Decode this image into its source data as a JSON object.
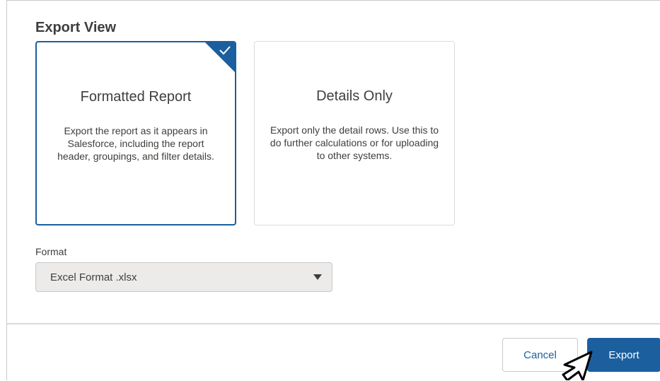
{
  "section": {
    "title": "Export View"
  },
  "cards": [
    {
      "title": "Formatted Report",
      "description": "Export the report as it appears in Salesforce, including the report header, groupings, and filter details.",
      "selected": true
    },
    {
      "title": "Details Only",
      "description": "Export only the detail rows. Use this to do further calculations or for uploading to other systems.",
      "selected": false
    }
  ],
  "format": {
    "label": "Format",
    "selected_value": "Excel Format .xlsx"
  },
  "footer": {
    "cancel_label": "Cancel",
    "export_label": "Export"
  },
  "icons": {
    "selected_check": "check-icon",
    "dropdown": "caret-down-icon",
    "pointer": "mouse-pointer-icon"
  },
  "colors": {
    "brand": "#1b5f9e",
    "text": "#3e3e3c",
    "border": "#dddbda",
    "select_bg": "#ecebea"
  }
}
